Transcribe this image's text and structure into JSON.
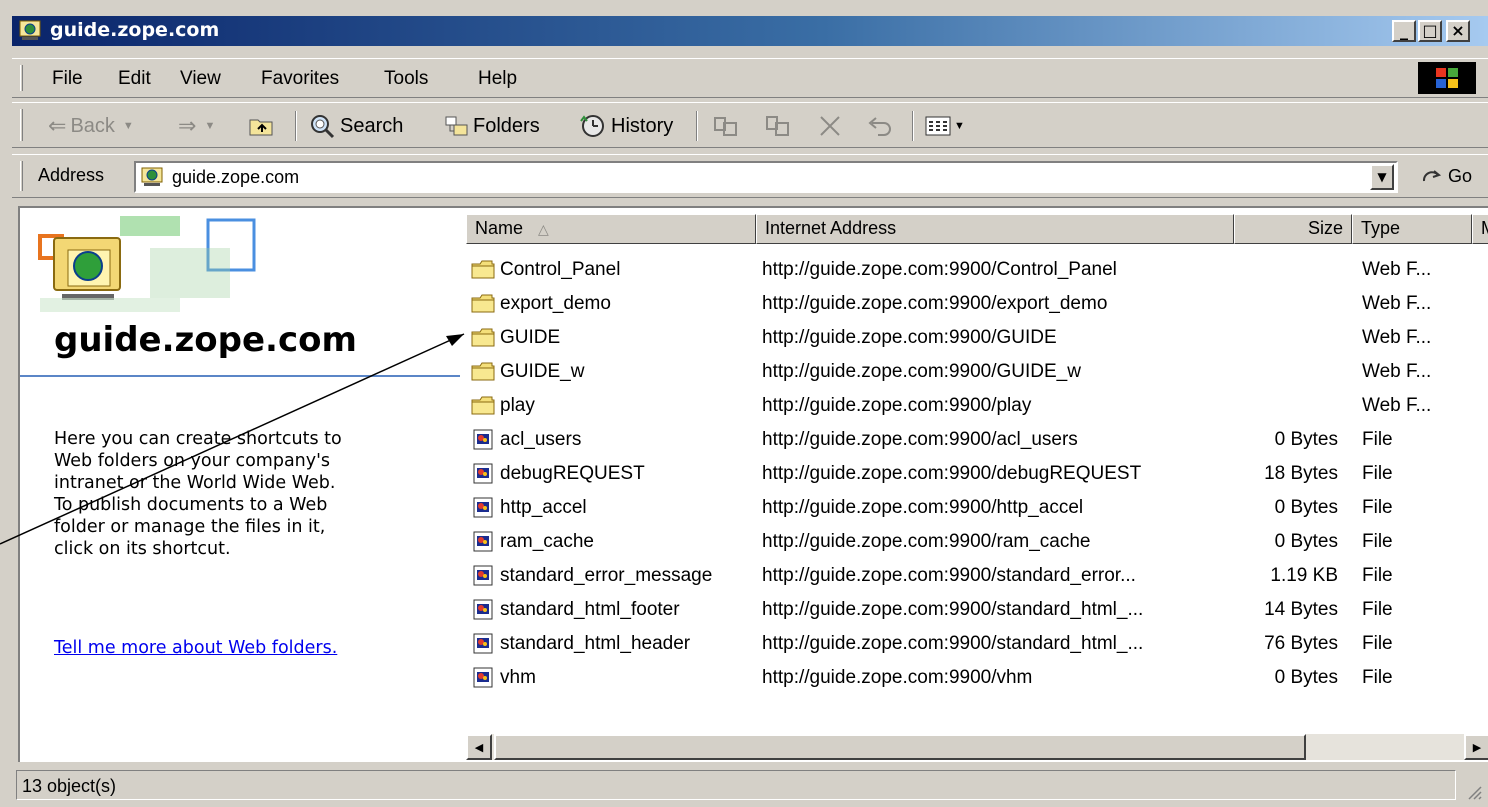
{
  "window": {
    "title": "guide.zope.com"
  },
  "menu": [
    "File",
    "Edit",
    "View",
    "Favorites",
    "Tools",
    "Help"
  ],
  "toolbar": {
    "back": "Back",
    "search": "Search",
    "folders": "Folders",
    "history": "History"
  },
  "address": {
    "label": "Address",
    "value": "guide.zope.com",
    "go": "Go"
  },
  "left_pane": {
    "title": "guide.zope.com",
    "description": "Here you can create shortcuts to\nWeb folders on your company's\nintranet or the World Wide Web.\nTo publish documents to a Web\nfolder or manage the files in it,\nclick on its shortcut.",
    "link": "Tell me more about Web folders."
  },
  "columns": {
    "name": "Name",
    "address": "Internet Address",
    "size": "Size",
    "type": "Type",
    "more": "M"
  },
  "rows": [
    {
      "icon": "folder-icon",
      "name": "Control_Panel",
      "address": "http://guide.zope.com:9900/Control_Panel",
      "size": "",
      "type": "Web F..."
    },
    {
      "icon": "folder-icon",
      "name": "export_demo",
      "address": "http://guide.zope.com:9900/export_demo",
      "size": "",
      "type": "Web F..."
    },
    {
      "icon": "folder-icon",
      "name": "GUIDE",
      "address": "http://guide.zope.com:9900/GUIDE",
      "size": "",
      "type": "Web F..."
    },
    {
      "icon": "folder-icon",
      "name": "GUIDE_w",
      "address": "http://guide.zope.com:9900/GUIDE_w",
      "size": "",
      "type": "Web F..."
    },
    {
      "icon": "folder-icon",
      "name": "play",
      "address": "http://guide.zope.com:9900/play",
      "size": "",
      "type": "Web F..."
    },
    {
      "icon": "file-icon",
      "name": "acl_users",
      "address": "http://guide.zope.com:9900/acl_users",
      "size": "0 Bytes",
      "type": "File"
    },
    {
      "icon": "file-icon",
      "name": "debugREQUEST",
      "address": "http://guide.zope.com:9900/debugREQUEST",
      "size": "18 Bytes",
      "type": "File"
    },
    {
      "icon": "file-icon",
      "name": "http_accel",
      "address": "http://guide.zope.com:9900/http_accel",
      "size": "0 Bytes",
      "type": "File"
    },
    {
      "icon": "file-icon",
      "name": "ram_cache",
      "address": "http://guide.zope.com:9900/ram_cache",
      "size": "0 Bytes",
      "type": "File"
    },
    {
      "icon": "file-icon",
      "name": "standard_error_message",
      "address": "http://guide.zope.com:9900/standard_error...",
      "size": "1.19 KB",
      "type": "File"
    },
    {
      "icon": "file-icon",
      "name": "standard_html_footer",
      "address": "http://guide.zope.com:9900/standard_html_...",
      "size": "14 Bytes",
      "type": "File"
    },
    {
      "icon": "file-icon",
      "name": "standard_html_header",
      "address": "http://guide.zope.com:9900/standard_html_...",
      "size": "76 Bytes",
      "type": "File"
    },
    {
      "icon": "file-icon",
      "name": "vhm",
      "address": "http://guide.zope.com:9900/vhm",
      "size": "0 Bytes",
      "type": "File"
    }
  ],
  "status": {
    "text": "13 object(s)"
  }
}
